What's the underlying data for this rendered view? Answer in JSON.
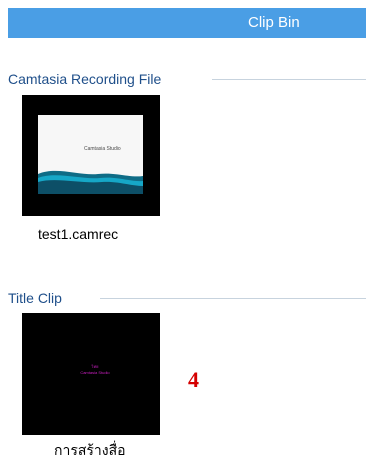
{
  "header": {
    "title": "Clip Bin"
  },
  "sections": [
    {
      "title": "Camtasia Recording File",
      "items": [
        {
          "label": "test1.camrec",
          "thumbnail_text": "Camtasia Studio"
        }
      ]
    },
    {
      "title": "Title Clip",
      "items": [
        {
          "label": "การสร้างสื่อ",
          "thumbnail_text_line1": "ไทย",
          "thumbnail_text_line2": "Camtasia Studio"
        }
      ]
    }
  ],
  "annotation": {
    "number": "4"
  },
  "colors": {
    "header_bg": "#4a9ee5",
    "section_title": "#1f4f8a",
    "divider": "#c7d3de",
    "annotation": "#d40000",
    "title_clip_text": "#cc1fc3"
  }
}
